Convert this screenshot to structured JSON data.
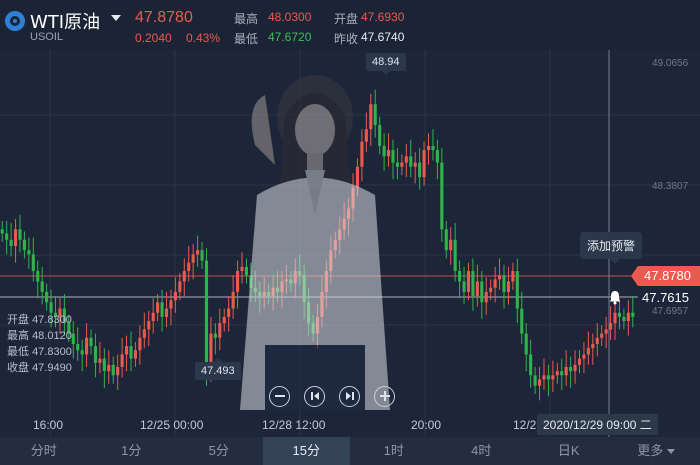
{
  "header": {
    "symbol_name": "WTI原油",
    "symbol_code": "USOIL",
    "last_price": "47.8780",
    "change": "0.2040",
    "change_pct": "0.43%",
    "high_label": "最高",
    "high_value": "48.0300",
    "low_label": "最低",
    "low_value": "47.6720",
    "open_label": "开盘",
    "open_value": "47.6930",
    "prev_close_label": "昨收",
    "prev_close_value": "47.6740"
  },
  "ohlc_panel": [
    {
      "label": "开盘",
      "value": "47.8300"
    },
    {
      "label": "最高",
      "value": "48.0120"
    },
    {
      "label": "最低",
      "value": "47.8300"
    },
    {
      "label": "收盘",
      "value": "47.9490"
    }
  ],
  "chart": {
    "max_tip": "48.94",
    "min_tip": "47.493",
    "y_ticks": [
      "49.0656",
      "48.3807",
      "47.6957"
    ],
    "current_price_flag": "47.8780",
    "alert_price": "47.7615",
    "add_alert_label": "添加预警",
    "crosshair_time": "2020/12/29 09:00 二",
    "x_ticks": [
      "16:00",
      "12/25 00:00",
      "12/28 12:00",
      "20:00",
      "12/2"
    ]
  },
  "colors": {
    "up": "#ea5a4f",
    "down": "#2fb34a",
    "background": "#1d2638"
  },
  "controls": [
    "zoom-out",
    "go-first",
    "go-last",
    "zoom-in"
  ],
  "tabs": [
    {
      "label": "分时",
      "active": false
    },
    {
      "label": "1分",
      "active": false
    },
    {
      "label": "5分",
      "active": false
    },
    {
      "label": "15分",
      "active": true
    },
    {
      "label": "1时",
      "active": false
    },
    {
      "label": "4时",
      "active": false
    },
    {
      "label": "日K",
      "active": false
    },
    {
      "label": "更多",
      "active": false
    }
  ],
  "chart_data": {
    "type": "candlestick",
    "y_range": [
      47.4,
      49.16
    ],
    "closes": [
      48.28,
      48.25,
      48.22,
      48.3,
      48.25,
      48.2,
      48.18,
      48.1,
      48.05,
      48.0,
      47.95,
      47.9,
      47.88,
      47.92,
      47.85,
      47.8,
      47.75,
      47.72,
      47.7,
      47.78,
      47.74,
      47.66,
      47.68,
      47.62,
      47.65,
      47.6,
      47.64,
      47.7,
      47.74,
      47.68,
      47.72,
      47.78,
      47.82,
      47.86,
      47.9,
      47.95,
      47.88,
      47.92,
      47.96,
      48.0,
      48.05,
      48.1,
      48.14,
      48.18,
      48.2,
      48.15,
      47.62,
      47.8,
      47.78,
      47.85,
      47.88,
      47.92,
      48.0,
      48.1,
      48.12,
      48.08,
      48.02,
      48.0,
      47.98,
      48.0,
      47.98,
      48.02,
      48.0,
      48.05,
      48.06,
      48.04,
      48.1,
      48.08,
      47.95,
      47.85,
      47.8,
      47.88,
      48.0,
      48.1,
      48.2,
      48.25,
      48.3,
      48.35,
      48.4,
      48.5,
      48.6,
      48.72,
      48.78,
      48.9,
      48.8,
      48.7,
      48.65,
      48.68,
      48.62,
      48.6,
      48.62,
      48.65,
      48.6,
      48.62,
      48.55,
      48.68,
      48.7,
      48.68,
      48.62,
      48.3,
      48.2,
      48.25,
      48.1,
      48.05,
      48.0,
      48.1,
      47.98,
      48.05,
      47.95,
      48.0,
      48.02,
      48.06,
      48.08,
      48.0,
      48.05,
      48.1,
      47.92,
      47.8,
      47.7,
      47.6,
      47.55,
      47.58,
      47.6,
      47.58,
      47.6,
      47.62,
      47.6,
      47.64,
      47.62,
      47.65,
      47.68,
      47.7,
      47.73,
      47.75,
      47.78,
      47.8,
      47.82,
      47.85,
      47.9,
      47.88,
      47.86,
      47.9,
      47.88
    ]
  }
}
